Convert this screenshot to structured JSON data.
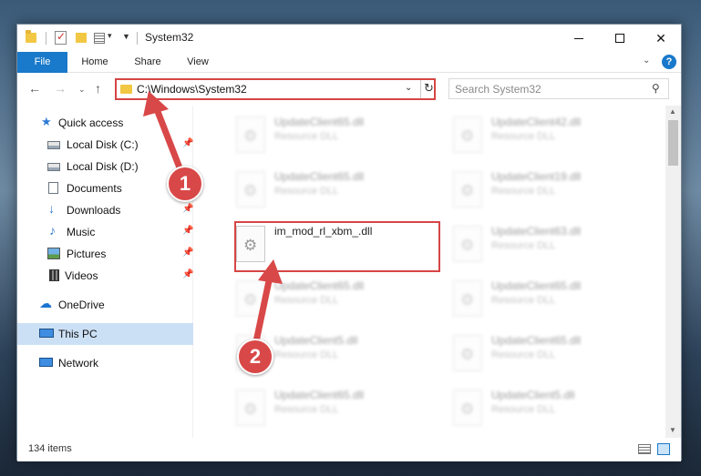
{
  "window": {
    "title": "System32",
    "min_glyph": "",
    "close_glyph": "✕"
  },
  "ribbon": {
    "tabs": [
      {
        "label": "File"
      },
      {
        "label": "Home"
      },
      {
        "label": "Share"
      },
      {
        "label": "View"
      }
    ],
    "help_glyph": "?",
    "expand_glyph": "⌄"
  },
  "nav": {
    "back_glyph": "←",
    "forward_glyph": "→",
    "recent_glyph": "⌄",
    "up_glyph": "↑"
  },
  "address": {
    "path": "C:\\Windows\\System32",
    "dropdown_glyph": "⌄",
    "refresh_glyph": "↻"
  },
  "search": {
    "placeholder": "Search System32",
    "icon_glyph": "⚲"
  },
  "sidebar": {
    "items": [
      {
        "label": "Quick access",
        "icon": "star-icon",
        "pinned": false
      },
      {
        "label": "Local Disk (C:)",
        "icon": "drive-icon",
        "pinned": true
      },
      {
        "label": "Local Disk (D:)",
        "icon": "drive-icon",
        "pinned": false
      },
      {
        "label": "Documents",
        "icon": "document-icon",
        "pinned": true
      },
      {
        "label": "Downloads",
        "icon": "download-icon",
        "pinned": true
      },
      {
        "label": "Music",
        "icon": "music-icon",
        "pinned": true
      },
      {
        "label": "Pictures",
        "icon": "pictures-icon",
        "pinned": true
      },
      {
        "label": "Videos",
        "icon": "videos-icon",
        "pinned": true
      },
      {
        "label": "OneDrive",
        "icon": "onedrive-icon",
        "pinned": false
      },
      {
        "label": "This PC",
        "icon": "this-pc-icon",
        "pinned": false,
        "selected": true
      },
      {
        "label": "Network",
        "icon": "network-icon",
        "pinned": false
      }
    ],
    "pin_glyph": "📌"
  },
  "files": [
    {
      "name": "UpdateClient65.dll",
      "type": "Resource DLL",
      "blurred": true
    },
    {
      "name": "UpdateClient42.dll",
      "type": "Resource DLL",
      "blurred": true
    },
    {
      "name": "UpdateClient65.dll",
      "type": "Resource DLL",
      "blurred": true
    },
    {
      "name": "UpdateClient19.dll",
      "type": "Resource DLL",
      "blurred": true
    },
    {
      "name": "im_mod_rl_xbm_.dll",
      "type": "",
      "blurred": false,
      "highlighted": true
    },
    {
      "name": "UpdateClient63.dll",
      "type": "Resource DLL",
      "blurred": true
    },
    {
      "name": "UpdateClient65.dll",
      "type": "Resource DLL",
      "blurred": true
    },
    {
      "name": "UpdateClient65.dll",
      "type": "Resource DLL",
      "blurred": true
    },
    {
      "name": "UpdateClient5.dll",
      "type": "Resource DLL",
      "blurred": true
    },
    {
      "name": "UpdateClient65.dll",
      "type": "Resource DLL",
      "blurred": true
    },
    {
      "name": "UpdateClient65.dll",
      "type": "Resource DLL",
      "blurred": true
    },
    {
      "name": "UpdateClient5.dll",
      "type": "Resource DLL",
      "blurred": true
    }
  ],
  "status": {
    "item_count": "134 items"
  },
  "annotations": {
    "badge_1": "1",
    "badge_2": "2",
    "accent_color": "#d94848"
  }
}
